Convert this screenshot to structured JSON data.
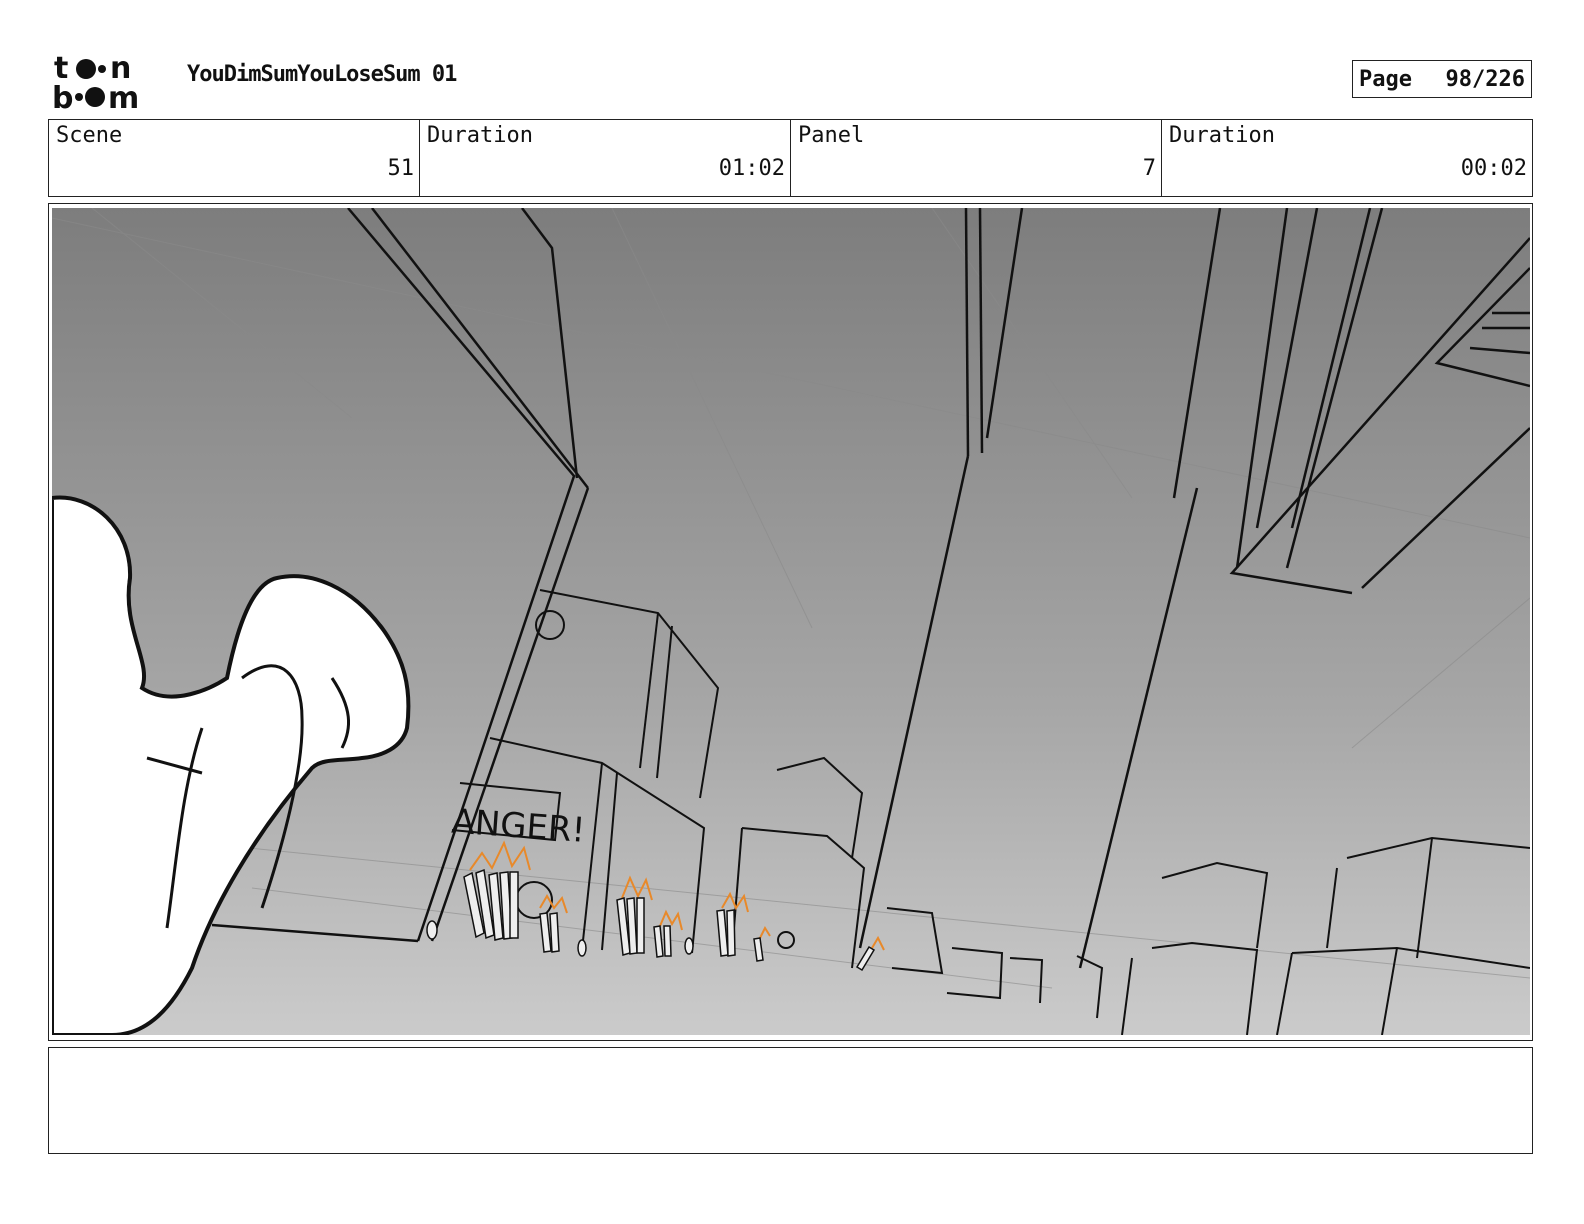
{
  "header": {
    "logo_text": "toon boom",
    "title": "YouDimSumYouLoseSum 01",
    "page_label": "Page",
    "page_value": "98/226"
  },
  "info": {
    "scene_label": "Scene",
    "scene_value": "51",
    "scene_duration_label": "Duration",
    "scene_duration_value": "01:02",
    "panel_label": "Panel",
    "panel_value": "7",
    "panel_duration_label": "Duration",
    "panel_duration_value": "00:02"
  },
  "panel": {
    "sign_text": "ANGER!",
    "accent_color": "#e8892a"
  },
  "notes": {
    "text": ""
  }
}
